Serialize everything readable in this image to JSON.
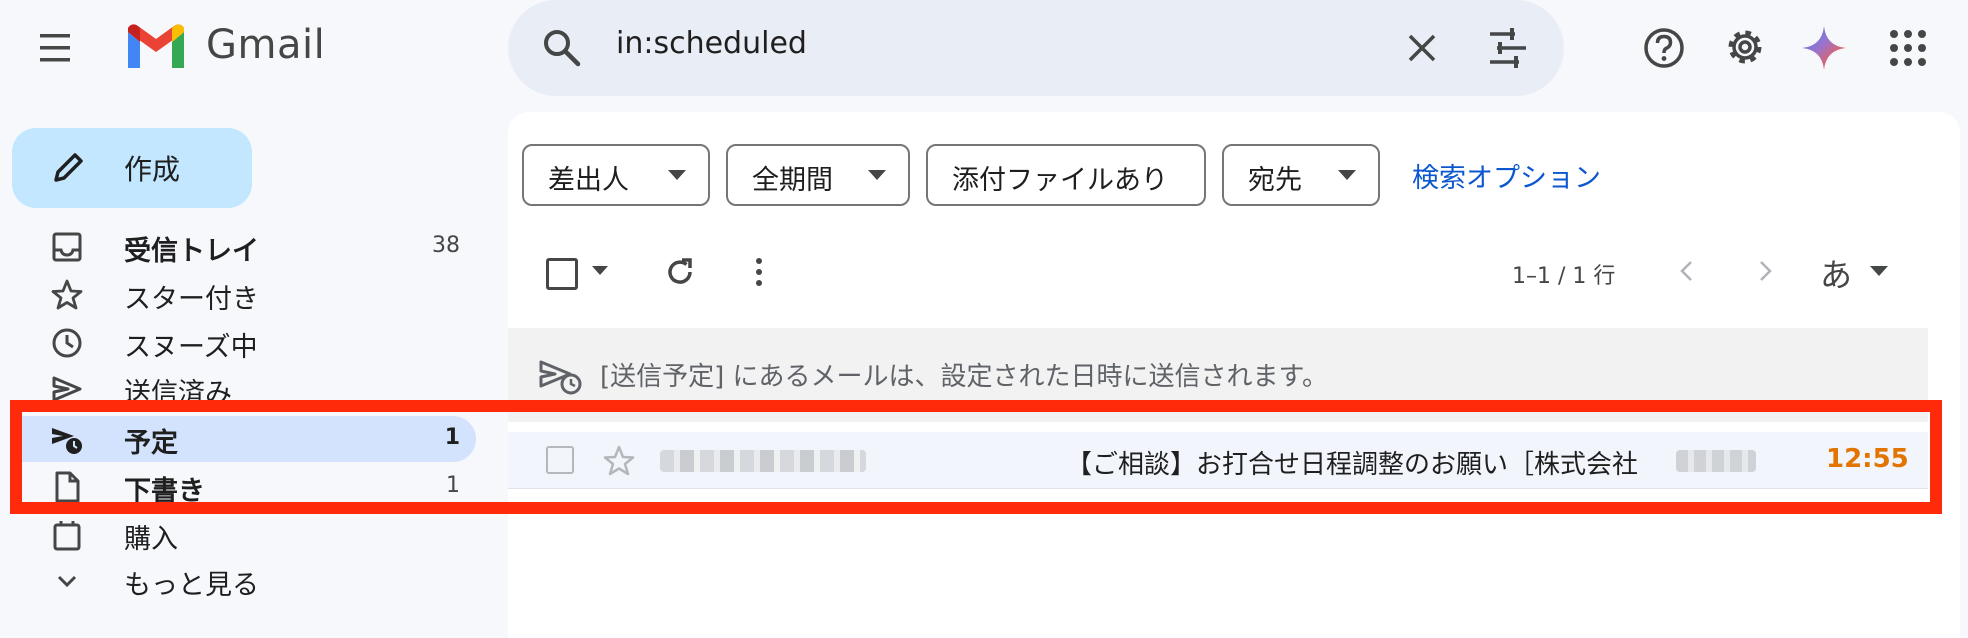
{
  "app": {
    "name": "Gmail"
  },
  "header": {
    "search_value": "in:scheduled"
  },
  "sidebar": {
    "compose_label": "作成",
    "items": [
      {
        "label": "受信トレイ",
        "count": "38",
        "icon": "inbox-icon",
        "bold": true
      },
      {
        "label": "スター付き",
        "count": "",
        "icon": "star-icon"
      },
      {
        "label": "スヌーズ中",
        "count": "",
        "icon": "clock-icon"
      },
      {
        "label": "送信済み",
        "count": "",
        "icon": "send-icon"
      },
      {
        "label": "予定",
        "count": "1",
        "icon": "scheduled-send-icon",
        "bold": true,
        "active": true
      },
      {
        "label": "下書き",
        "count": "1",
        "icon": "draft-icon",
        "bold": true
      },
      {
        "label": "購入",
        "count": "",
        "icon": "purchase-icon"
      },
      {
        "label": "もっと見る",
        "count": "",
        "icon": "chevron-down-icon"
      }
    ]
  },
  "filters": {
    "chips": [
      "差出人",
      "全期間",
      "添付ファイルあり",
      "宛先"
    ],
    "search_options": "検索オプション"
  },
  "toolbar": {
    "page_info": "1–1 / 1 行",
    "input_tool": "あ"
  },
  "banner": {
    "text": "[送信予定] にあるメールは、設定された日時に送信されます。"
  },
  "emails": [
    {
      "subject": "【ご相談】お打合せ日程調整のお願い［株式会社",
      "time": "12:55"
    }
  ],
  "colors": {
    "accent": "#0b57d0",
    "compose_bg": "#c2e7ff",
    "active_nav": "#d3e3fd",
    "time": "#e37400",
    "highlight": "#ff2a0a"
  }
}
